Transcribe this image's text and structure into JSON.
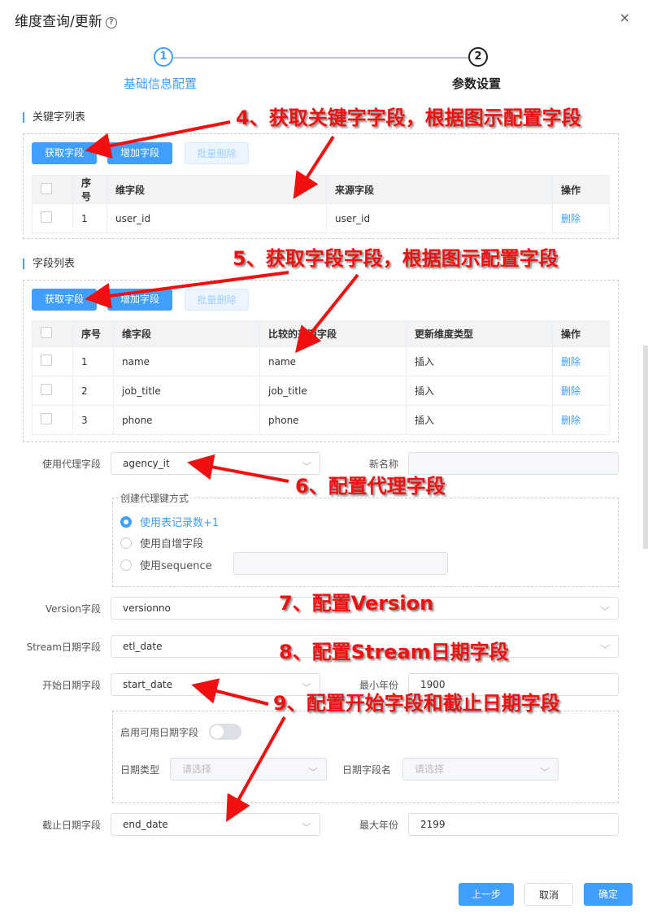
{
  "dialog": {
    "title": "维度查询/更新",
    "help_icon": "?",
    "close_icon": "×"
  },
  "steps": [
    {
      "num": "1",
      "label": "基础信息配置",
      "color": "#409eff"
    },
    {
      "num": "2",
      "label": "参数设置",
      "color": "#222222"
    }
  ],
  "key_section": {
    "title": "关键字列表",
    "buttons": {
      "fetch": "获取字段",
      "add": "增加字段",
      "batch_delete": "批量删除"
    },
    "headers": [
      "",
      "序号",
      "维字段",
      "来源字段",
      "操作"
    ],
    "rows": [
      {
        "index": "1",
        "dim": "user_id",
        "source": "user_id",
        "action": "删除"
      }
    ]
  },
  "field_section": {
    "title": "字段列表",
    "buttons": {
      "fetch": "获取字段",
      "add": "增加字段",
      "batch_delete": "批量删除"
    },
    "headers": [
      "",
      "序号",
      "维字段",
      "比较的来源字段",
      "更新维度类型",
      "操作"
    ],
    "rows": [
      {
        "index": "1",
        "dim": "name",
        "source": "name",
        "type": "插入",
        "action": "删除"
      },
      {
        "index": "2",
        "dim": "job_title",
        "source": "job_title",
        "type": "插入",
        "action": "删除"
      },
      {
        "index": "3",
        "dim": "phone",
        "source": "phone",
        "type": "插入",
        "action": "删除"
      }
    ]
  },
  "form": {
    "agency": {
      "label": "使用代理字段",
      "value": "agency_it"
    },
    "new_name": {
      "label": "新名称",
      "value": ""
    },
    "surrogate": {
      "legend": "创建代理键方式",
      "options": [
        "使用表记录数+1",
        "使用自增字段",
        "使用sequence"
      ],
      "selected": 0,
      "sequence_value": ""
    },
    "version": {
      "label": "Version字段",
      "value": "versionno"
    },
    "stream_date": {
      "label": "Stream日期字段",
      "value": "etl_date"
    },
    "start_date": {
      "label": "开始日期字段",
      "value": "start_date"
    },
    "min_year": {
      "label": "最小年份",
      "value": "1900"
    },
    "enable_date": {
      "label": "启用可用日期字段",
      "on": false
    },
    "date_type": {
      "label": "日期类型",
      "placeholder": "请选择"
    },
    "date_field": {
      "label": "日期字段名",
      "placeholder": "请选择"
    },
    "end_date": {
      "label": "截止日期字段",
      "value": "end_date"
    },
    "max_year": {
      "label": "最大年份",
      "value": "2199"
    }
  },
  "footer": {
    "prev": "上一步",
    "cancel": "取消",
    "ok": "确定"
  },
  "annotations": [
    "4、获取关键字字段，根据图示配置字段",
    "5、获取字段字段，根据图示配置字段",
    "6、配置代理字段",
    "7、配置Version",
    "8、配置Stream日期字段",
    "9、配置开始字段和截止日期字段"
  ],
  "colors": {
    "accent": "#409eff",
    "annotation": "#f01010"
  }
}
